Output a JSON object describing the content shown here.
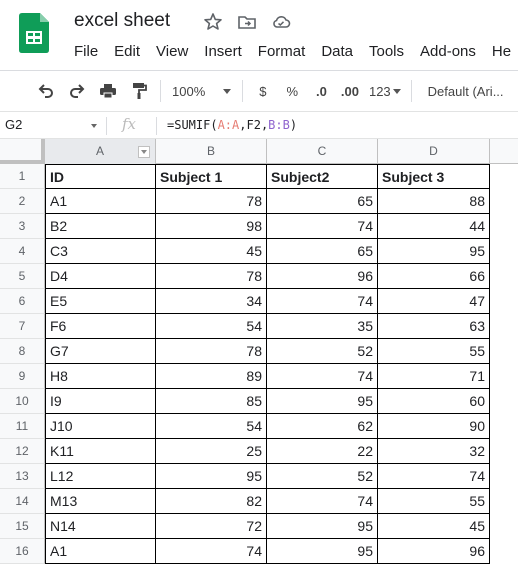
{
  "app": {
    "doc_title": "excel sheet",
    "brand_color": "#0f9d58"
  },
  "menu": [
    "File",
    "Edit",
    "View",
    "Insert",
    "Format",
    "Data",
    "Tools",
    "Add-ons",
    "He"
  ],
  "toolbar": {
    "zoom": "100%",
    "currency": "$",
    "percent": "%",
    "decrease_decimal": ".0",
    "increase_decimal": ".00",
    "more_formats": "123",
    "font": "Default (Ari..."
  },
  "formula_bar": {
    "cell_ref": "G2",
    "fx": "fx",
    "formula_prefix": "=SUMIF(",
    "formula_range1": "A:A",
    "formula_mid": ",F2,",
    "formula_range2": "B:B",
    "formula_suffix": ")"
  },
  "columns": [
    "A",
    "B",
    "C",
    "D"
  ],
  "rows": [
    [
      "ID",
      "Subject 1",
      "Subject2",
      "Subject 3"
    ],
    [
      "A1",
      "78",
      "65",
      "88"
    ],
    [
      "B2",
      "98",
      "74",
      "44"
    ],
    [
      "C3",
      "45",
      "65",
      "95"
    ],
    [
      "D4",
      "78",
      "96",
      "66"
    ],
    [
      "E5",
      "34",
      "74",
      "47"
    ],
    [
      "F6",
      "54",
      "35",
      "63"
    ],
    [
      "G7",
      "78",
      "52",
      "55"
    ],
    [
      "H8",
      "89",
      "74",
      "71"
    ],
    [
      "I9",
      "85",
      "95",
      "60"
    ],
    [
      "J10",
      "54",
      "62",
      "90"
    ],
    [
      "K11",
      "25",
      "22",
      "32"
    ],
    [
      "L12",
      "95",
      "52",
      "74"
    ],
    [
      "M13",
      "82",
      "74",
      "55"
    ],
    [
      "N14",
      "72",
      "95",
      "45"
    ],
    [
      "A1",
      "74",
      "95",
      "96"
    ]
  ]
}
